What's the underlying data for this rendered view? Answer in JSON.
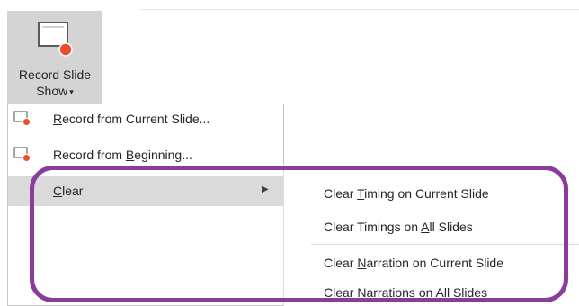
{
  "ribbon": {
    "button_line1": "Record Slide",
    "button_line2": "Show",
    "caret": "▾",
    "icon": "record-slide-icon"
  },
  "menu": {
    "items": [
      {
        "pre": "",
        "mnemonic": "R",
        "post": "ecord from Current Slide...",
        "icon": "record-icon"
      },
      {
        "pre": "Record from ",
        "mnemonic": "B",
        "post": "eginning...",
        "icon": "record-icon"
      },
      {
        "pre": "",
        "mnemonic": "C",
        "post": "lear",
        "icon": "",
        "arrow": "▶"
      }
    ]
  },
  "submenu": {
    "items": [
      {
        "pre": "Clear ",
        "mnemonic": "T",
        "post": "iming on Current Slide"
      },
      {
        "pre": "Clear Timings on ",
        "mnemonic": "A",
        "post": "ll Slides"
      },
      {
        "pre": "Clear ",
        "mnemonic": "N",
        "post": "arration on Current Slide"
      },
      {
        "pre": "Clear Narrations on All ",
        "mnemonic": "S",
        "post": "lides"
      }
    ]
  },
  "colors": {
    "annotation": "#8a3c9a",
    "record_dot": "#e8502d",
    "menu_highlight": "#dadada"
  }
}
